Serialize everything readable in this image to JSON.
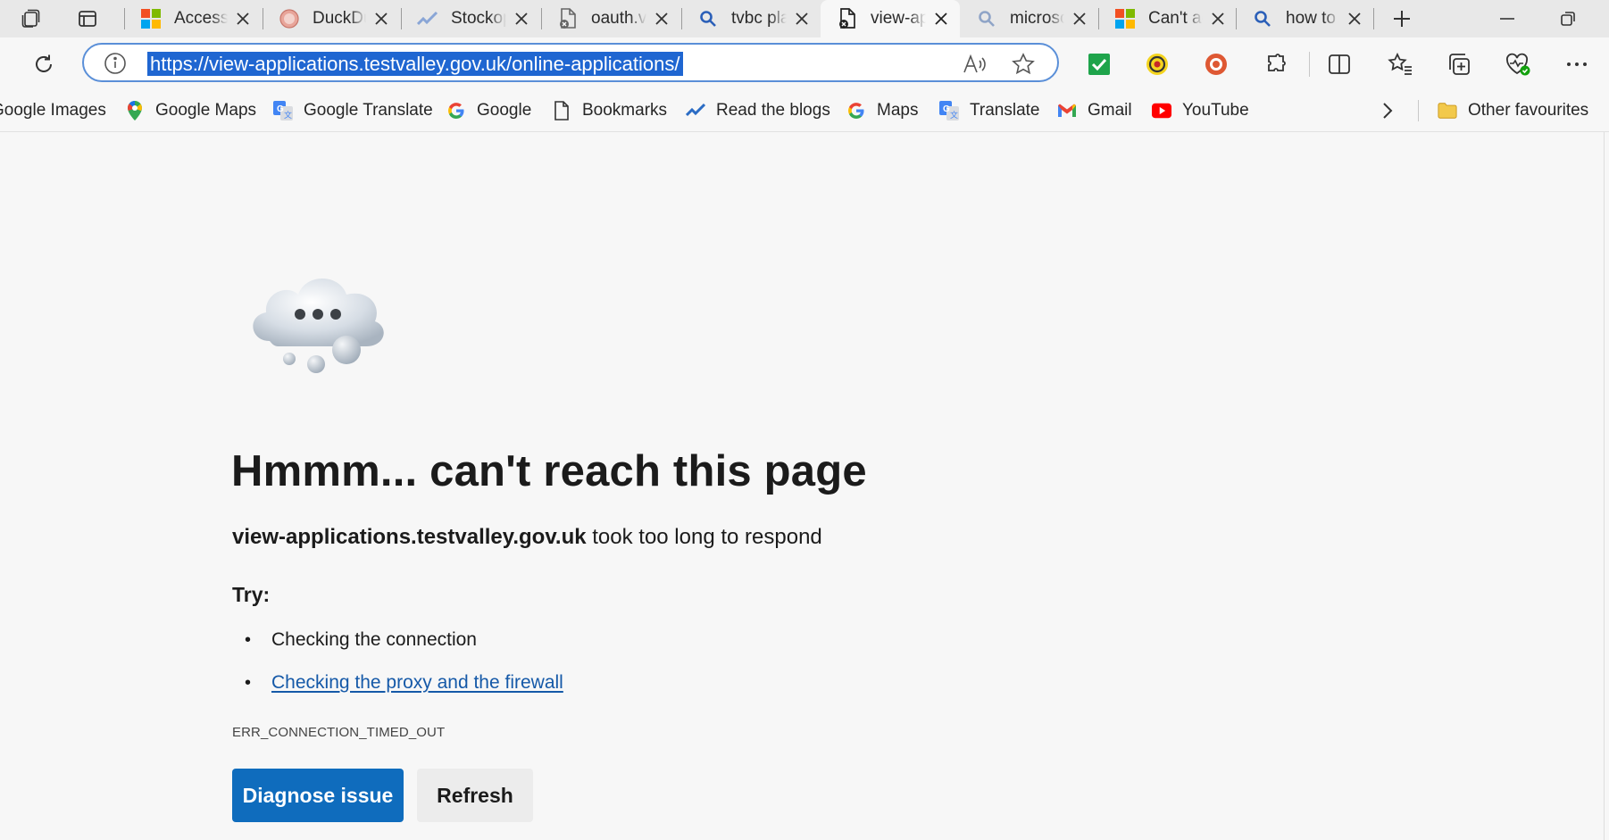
{
  "tabs": [
    {
      "label": "Access",
      "favicon": "microsoft-logo-icon",
      "active": false
    },
    {
      "label": "DuckDuckGo",
      "favicon": "duckduckgo-icon",
      "active": false
    },
    {
      "label": "Stockopedia",
      "favicon": "stocko-icon",
      "active": false
    },
    {
      "label": "oauth.v",
      "favicon": "page-error-icon",
      "active": false
    },
    {
      "label": "tvbc planning",
      "favicon": "search-icon",
      "active": false
    },
    {
      "label": "view-applications",
      "favicon": "page-error-icon",
      "active": true
    },
    {
      "label": "microsoft",
      "favicon": "search-icon",
      "active": false
    },
    {
      "label": "Can't access",
      "favicon": "microsoft-logo-icon",
      "active": false
    },
    {
      "label": "how to",
      "favicon": "search-icon",
      "active": false
    }
  ],
  "address_bar": {
    "url": "https://view-applications.testvalley.gov.uk/online-applications/"
  },
  "favourites": [
    {
      "label": "Google Images",
      "icon": "google-images-icon"
    },
    {
      "label": "Google Maps",
      "icon": "google-maps-icon"
    },
    {
      "label": "Google Translate",
      "icon": "google-translate-icon"
    },
    {
      "label": "Google",
      "icon": "google-icon"
    },
    {
      "label": "Bookmarks",
      "icon": "page-icon"
    },
    {
      "label": "Read the blogs",
      "icon": "stocko-icon"
    },
    {
      "label": "Maps",
      "icon": "google-icon"
    },
    {
      "label": "Translate",
      "icon": "google-translate-icon"
    },
    {
      "label": "Gmail",
      "icon": "gmail-icon"
    },
    {
      "label": "YouTube",
      "icon": "youtube-icon"
    }
  ],
  "other_favourites": "Other favourites",
  "error": {
    "title": "Hmmm... can't reach this page",
    "host": "view-applications.testvalley.gov.uk",
    "message": " took too long to respond",
    "try_label": "Try:",
    "suggestions": [
      {
        "text": "Checking the connection",
        "link": false
      },
      {
        "text": "Checking the proxy and the firewall",
        "link": true
      }
    ],
    "code": "ERR_CONNECTION_TIMED_OUT",
    "diagnose_label": "Diagnose issue",
    "refresh_label": "Refresh"
  },
  "colors": {
    "accent": "#0f6cbd",
    "link": "#1559a8",
    "url_highlight": "#1f66d1"
  }
}
